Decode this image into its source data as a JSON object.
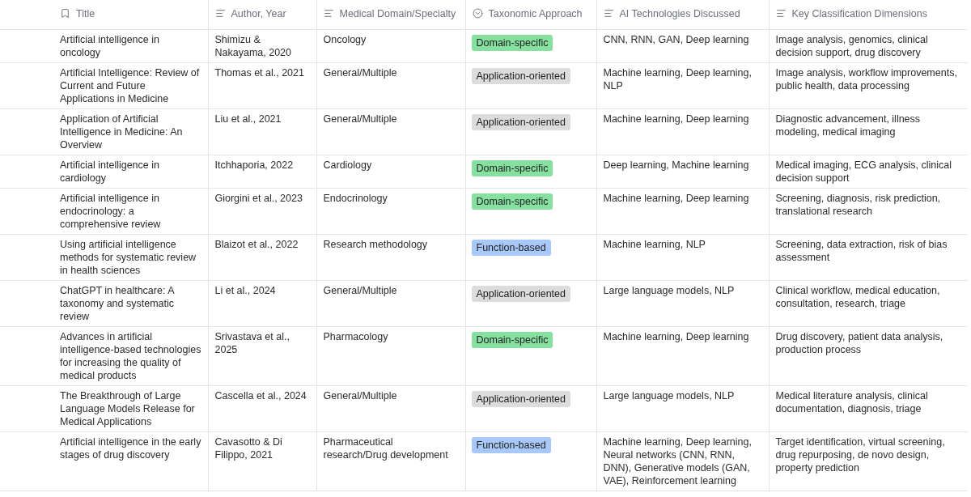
{
  "table": {
    "columns": [
      {
        "label": "Title",
        "kind": "title"
      },
      {
        "label": "Author, Year",
        "kind": "text"
      },
      {
        "label": "Medical Domain/Specialty",
        "kind": "text"
      },
      {
        "label": "Taxonomic Approach",
        "kind": "select"
      },
      {
        "label": "AI Technologies Discussed",
        "kind": "text"
      },
      {
        "label": "Key Classification Dimensions",
        "kind": "text"
      }
    ],
    "rows": [
      {
        "title": "Artificial intelligence in oncology",
        "author": "Shimizu & Nakayama, 2020",
        "domain": "Oncology",
        "approach": {
          "label": "Domain-specific",
          "color": "#86e0a0"
        },
        "technologies": "CNN, RNN, GAN, Deep learning",
        "dimensions": "Image analysis, genomics, clinical decision support, drug discovery"
      },
      {
        "title": "Artificial Intelligence: Review of Current and Future Applications in Medicine",
        "author": "Thomas et al., 2021",
        "domain": "General/Multiple",
        "approach": {
          "label": "Application-oriented",
          "color": "#dcdcdc"
        },
        "technologies": "Machine learning, Deep learning, NLP",
        "dimensions": "Image analysis, workflow improvements, public health, data processing"
      },
      {
        "title": "Application of Artificial Intelligence in Medicine: An Overview",
        "author": "Liu et al., 2021",
        "domain": "General/Multiple",
        "approach": {
          "label": "Application-oriented",
          "color": "#dcdcdc"
        },
        "technologies": "Machine learning, Deep learning",
        "dimensions": "Diagnostic advancement, illness modeling, medical imaging"
      },
      {
        "title": "Artificial intelligence in cardiology",
        "author": "Itchhaporia, 2022",
        "domain": "Cardiology",
        "approach": {
          "label": "Domain-specific",
          "color": "#86e0a0"
        },
        "technologies": "Deep learning, Machine learning",
        "dimensions": "Medical imaging, ECG analysis, clinical decision support"
      },
      {
        "title": "Artificial intelligence in endocrinology: a comprehensive review",
        "author": "Giorgini et al., 2023",
        "domain": "Endocrinology",
        "approach": {
          "label": "Domain-specific",
          "color": "#86e0a0"
        },
        "technologies": "Machine learning, Deep learning",
        "dimensions": "Screening, diagnosis, risk prediction, translational research"
      },
      {
        "title": "Using artificial intelligence methods for systematic review in health sciences",
        "author": "Blaizot et al., 2022",
        "domain": "Research methodology",
        "approach": {
          "label": "Function-based",
          "color": "#a8c9f7"
        },
        "technologies": "Machine learning, NLP",
        "dimensions": "Screening, data extraction, risk of bias assessment"
      },
      {
        "title": "ChatGPT in healthcare: A taxonomy and systematic review",
        "author": "Li et al., 2024",
        "domain": "General/Multiple",
        "approach": {
          "label": "Application-oriented",
          "color": "#dcdcdc"
        },
        "technologies": "Large language models, NLP",
        "dimensions": "Clinical workflow, medical education, consultation, research, triage"
      },
      {
        "title": "Advances in artificial intelligence-based technologies for increasing the quality of medical products",
        "author": "Srivastava et al., 2025",
        "domain": "Pharmacology",
        "approach": {
          "label": "Domain-specific",
          "color": "#86e0a0"
        },
        "technologies": "Machine learning, Deep learning",
        "dimensions": "Drug discovery, patient data analysis, production process"
      },
      {
        "title": "The Breakthrough of Large Language Models Release for Medical Applications",
        "author": "Cascella et al., 2024",
        "domain": "General/Multiple",
        "approach": {
          "label": "Application-oriented",
          "color": "#dcdcdc"
        },
        "technologies": "Large language models, NLP",
        "dimensions": "Medical literature analysis, clinical documentation, diagnosis, triage"
      },
      {
        "title": "Artificial intelligence in the early stages of drug discovery",
        "author": "Cavasotto & Di Filippo, 2021",
        "domain": "Pharmaceutical research/Drug development",
        "approach": {
          "label": "Function-based",
          "color": "#a8c9f7"
        },
        "technologies": "Machine learning, Deep learning, Neural networks (CNN, RNN, DNN), Generative models (GAN, VAE), Reinforcement learning",
        "dimensions": "Target identification, virtual screening, drug repurposing, de novo design, property prediction"
      }
    ]
  }
}
